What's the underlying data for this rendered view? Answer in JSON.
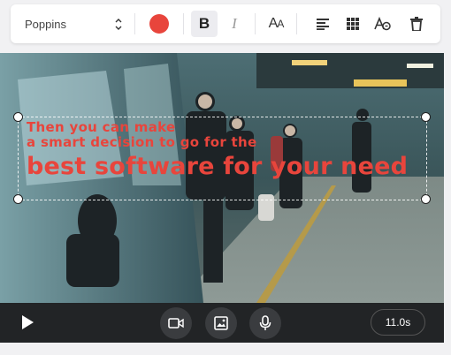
{
  "toolbar": {
    "font_family": "Poppins",
    "text_color": "#e8453c",
    "bold_label": "B",
    "italic_label": "I",
    "font_size_label": "AA"
  },
  "canvas": {
    "overlay_lines": [
      "Then you can make",
      "a smart decision to go for the",
      "best software for your need"
    ]
  },
  "bottom_bar": {
    "duration": "11.0s",
    "icons": [
      "play-icon",
      "video-camera-icon",
      "image-icon",
      "microphone-icon"
    ]
  }
}
